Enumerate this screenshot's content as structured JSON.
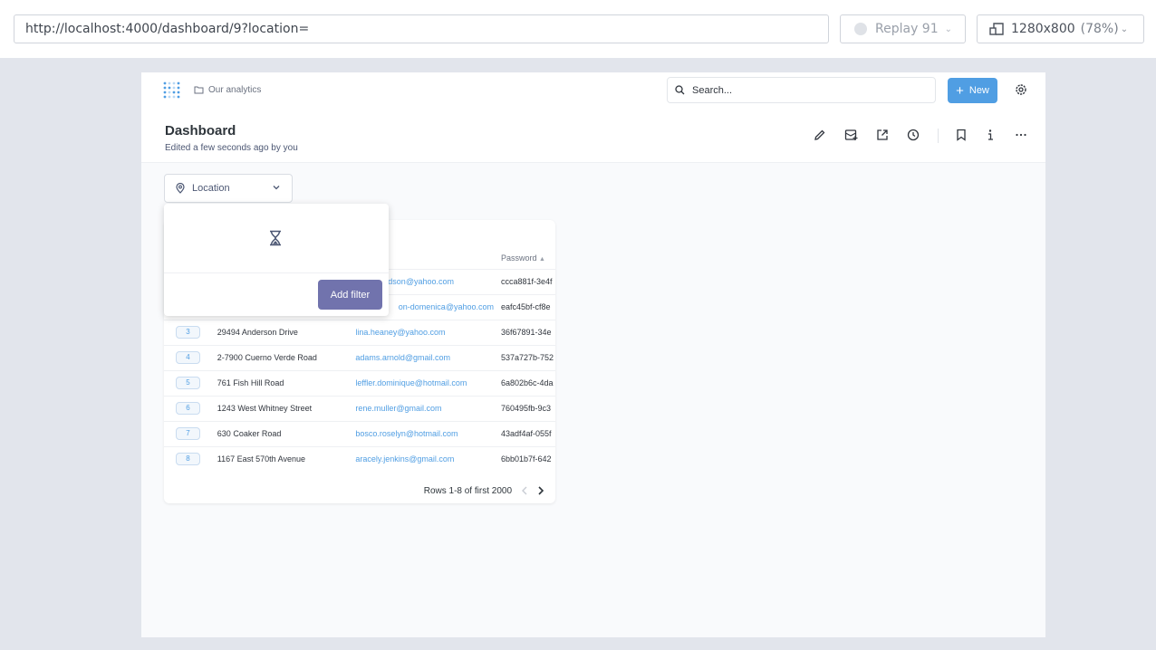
{
  "replay_bar": {
    "url": "http://localhost:4000/dashboard/9?location=",
    "replay_label": "Replay 91",
    "viewport_size": "1280x800",
    "viewport_zoom": "(78%)"
  },
  "app": {
    "breadcrumb": "Our analytics",
    "search_placeholder": "Search...",
    "new_button": "New",
    "dashboard_title": "Dashboard",
    "edited_text": "Edited a few seconds ago by you"
  },
  "filter": {
    "label": "Location",
    "add_filter_button": "Add filter"
  },
  "table": {
    "columns": [
      "",
      "",
      "",
      "Password"
    ],
    "rows": [
      {
        "id": "",
        "address": "",
        "email": "dson@yahoo.com",
        "password": "ccca881f-3e4f"
      },
      {
        "id": "",
        "address": "",
        "email": "on-domenica@yahoo.com",
        "password": "eafc45bf-cf8e"
      },
      {
        "id": "3",
        "address": "29494 Anderson Drive",
        "email": "lina.heaney@yahoo.com",
        "password": "36f67891-34e"
      },
      {
        "id": "4",
        "address": "2-7900 Cuerno Verde Road",
        "email": "adams.arnold@gmail.com",
        "password": "537a727b-752"
      },
      {
        "id": "5",
        "address": "761 Fish Hill Road",
        "email": "leffler.dominique@hotmail.com",
        "password": "6a802b6c-4da"
      },
      {
        "id": "6",
        "address": "1243 West Whitney Street",
        "email": "rene.muller@gmail.com",
        "password": "760495fb-9c3"
      },
      {
        "id": "7",
        "address": "630 Coaker Road",
        "email": "bosco.roselyn@hotmail.com",
        "password": "43adf4af-055f"
      },
      {
        "id": "8",
        "address": "1167 East 570th Avenue",
        "email": "aracely.jenkins@gmail.com",
        "password": "6bb01b7f-642"
      }
    ],
    "pagination": "Rows 1-8 of first 2000"
  },
  "colors": {
    "brand_blue": "#509ee3",
    "filter_purple": "#7173ad"
  }
}
